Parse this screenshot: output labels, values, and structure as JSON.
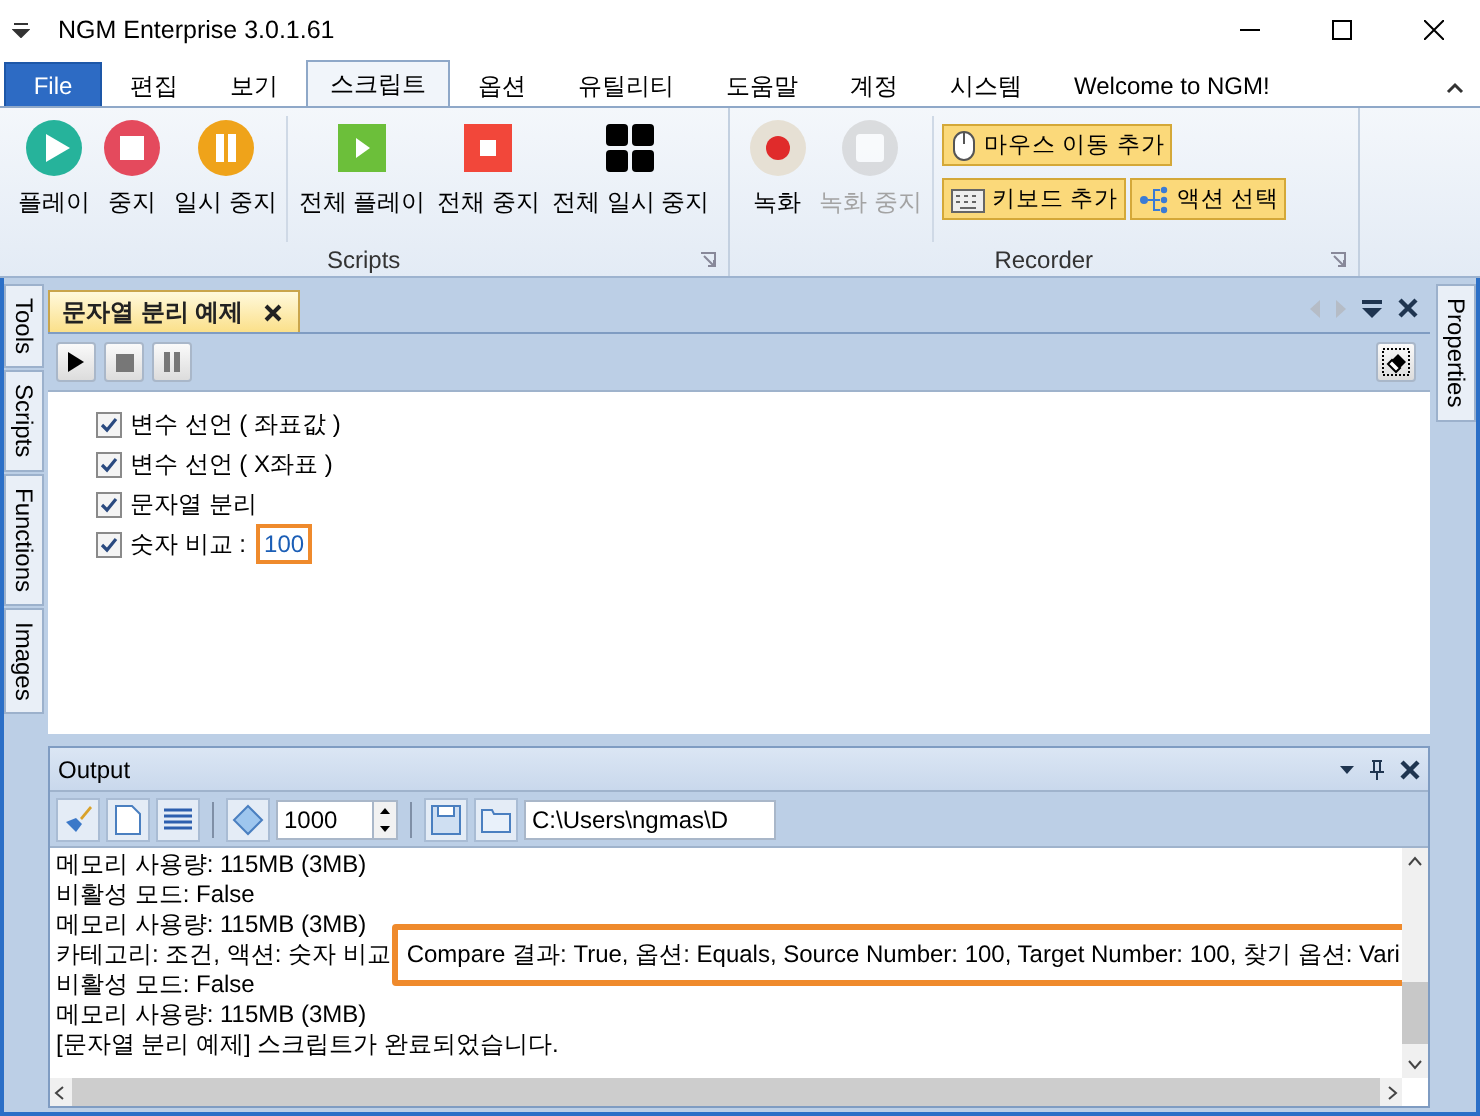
{
  "window": {
    "title": "NGM Enterprise 3.0.1.61"
  },
  "menu_tabs": [
    {
      "label": "File",
      "kind": "file",
      "selected": false
    },
    {
      "label": "편집",
      "kind": "tab",
      "selected": false
    },
    {
      "label": "보기",
      "kind": "tab",
      "selected": false
    },
    {
      "label": "스크립트",
      "kind": "tab",
      "selected": true
    },
    {
      "label": "옵션",
      "kind": "tab",
      "selected": false
    },
    {
      "label": "유틸리티",
      "kind": "tab",
      "selected": false
    },
    {
      "label": "도움말",
      "kind": "tab",
      "selected": false
    },
    {
      "label": "계정",
      "kind": "tab",
      "selected": false
    },
    {
      "label": "시스템",
      "kind": "tab",
      "selected": false
    },
    {
      "label": "Welcome to NGM!",
      "kind": "tab",
      "selected": false
    }
  ],
  "ribbon_groups": [
    {
      "title": "Scripts",
      "sections": [
        [
          {
            "label": "플레이",
            "kind": "play-circle",
            "disabled": false
          },
          {
            "label": "중지",
            "kind": "stop-circle",
            "disabled": false
          },
          {
            "label": "일시 중지",
            "kind": "pause-circle",
            "disabled": false
          }
        ],
        [
          {
            "label": "전체 플레이",
            "kind": "play-square",
            "disabled": false
          },
          {
            "label": "전채 중지",
            "kind": "stop-square",
            "disabled": false
          },
          {
            "label": "전체 일시 중지",
            "kind": "grid",
            "disabled": false
          }
        ]
      ]
    },
    {
      "title": "Recorder",
      "sections": [
        [
          {
            "label": "녹화",
            "kind": "record",
            "disabled": false
          },
          {
            "label": "녹화 중지",
            "kind": "record-stop",
            "disabled": true
          }
        ],
        [
          {
            "label": "마우스 이동 추가",
            "kind": "mouse",
            "disabled": false
          },
          {
            "label": "키보드 추가",
            "kind": "keyboard",
            "disabled": false
          },
          {
            "label": "액션 선택",
            "kind": "flow",
            "disabled": false
          }
        ]
      ]
    }
  ],
  "left_side_tabs": [
    "Tools",
    "Scripts",
    "Functions",
    "Images"
  ],
  "right_side_tabs": [
    "Properties"
  ],
  "document": {
    "tab": {
      "title": "문자열 분리 예제",
      "selected": true
    },
    "steps": [
      {
        "label": "변수 선언 ( 좌표값 )",
        "checked": true
      },
      {
        "label": "변수 선언 ( X좌표 )",
        "checked": true
      },
      {
        "label": "문자열 분리",
        "checked": true
      },
      {
        "label": "숫자 비교 :",
        "value": "100",
        "checked": true
      }
    ]
  },
  "output": {
    "title": "Output",
    "line_limit": "1000",
    "path": "C:\\Users\\ngmas\\D",
    "lines": [
      {
        "text": "메모리 사용량: 115MB (3MB)"
      },
      {
        "text": "비활성 모드: False"
      },
      {
        "text": "메모리 사용량: 115MB (3MB)"
      },
      {
        "text": "카테고리: 조건, 액션: 숫자 비교",
        "tooltip": "Compare 결과: True, 옵션: Equals, Source Number: 100, Target Number: 100, 찾기 옵션: Vari"
      },
      {
        "text": "비활성 모드: False"
      },
      {
        "text": "메모리 사용량: 115MB (3MB)"
      },
      {
        "text": "[문자열 분리 예제] 스크립트가 완료되었습니다."
      }
    ]
  }
}
